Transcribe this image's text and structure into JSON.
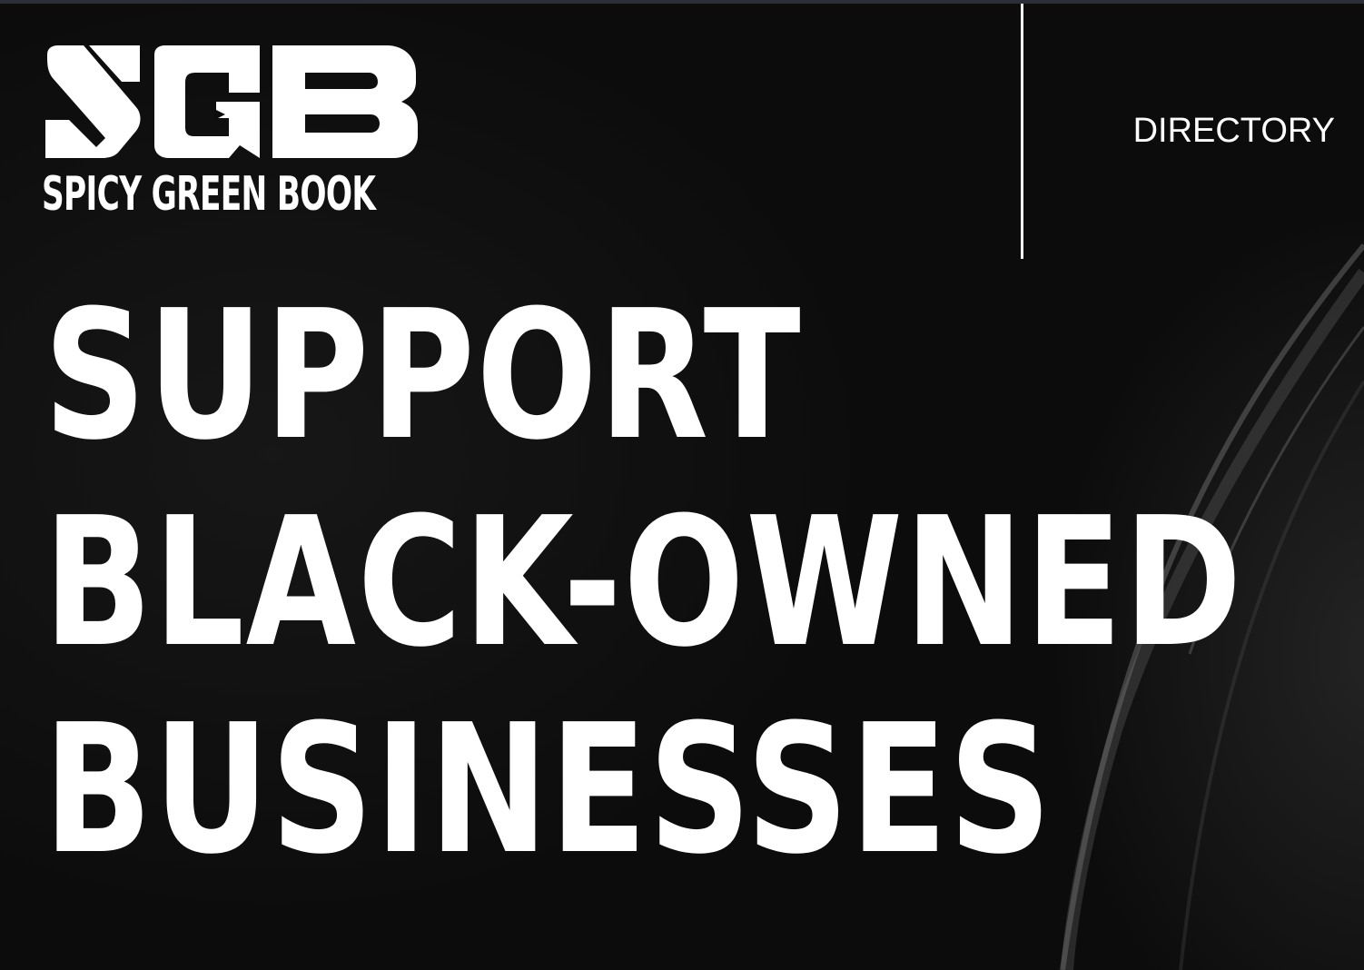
{
  "logo": {
    "monogram": "SGB",
    "name": "SPICY GREEN BOOK"
  },
  "nav": {
    "directory_label": "DIRECTORY"
  },
  "hero": {
    "lines": [
      "SUPPORT",
      "BLACK-OWNED",
      "BUSINESSES"
    ]
  },
  "colors": {
    "background": "#0c0c0c",
    "text": "#ffffff",
    "top_strip": "#2b2e38"
  }
}
